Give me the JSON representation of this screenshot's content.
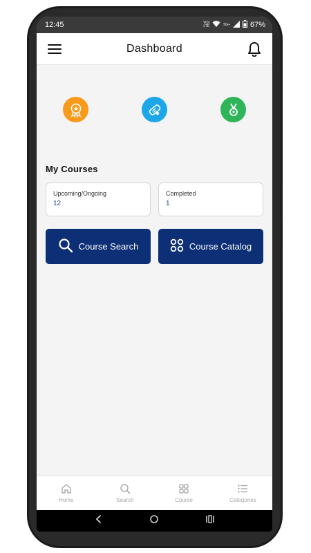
{
  "status": {
    "time": "12:45",
    "network_top": "Vo))",
    "network_bottom": "LTE",
    "signal_label": "5G+",
    "battery": "67%"
  },
  "appbar": {
    "title": "Dashboard"
  },
  "badges": [
    {
      "name": "award-badge",
      "color": "#F89A1C"
    },
    {
      "name": "certificate-badge",
      "color": "#1EA7E8"
    },
    {
      "name": "medal-badge",
      "color": "#2EB55A"
    }
  ],
  "my_courses": {
    "title": "My Courses",
    "upcoming": {
      "label": "Upcoming/Ongoing",
      "value": "12"
    },
    "completed": {
      "label": "Completed",
      "value": "1"
    }
  },
  "actions": {
    "search_label": "Course Search",
    "catalog_label": "Course Catalog"
  },
  "tabs": [
    {
      "label": "Home",
      "icon": "home-icon"
    },
    {
      "label": "Search",
      "icon": "search-icon"
    },
    {
      "label": "Course",
      "icon": "grid-icon"
    },
    {
      "label": "Categories",
      "icon": "list-icon"
    }
  ],
  "colors": {
    "primary": "#0D2F76",
    "accent_value": "#1C3F8A"
  }
}
